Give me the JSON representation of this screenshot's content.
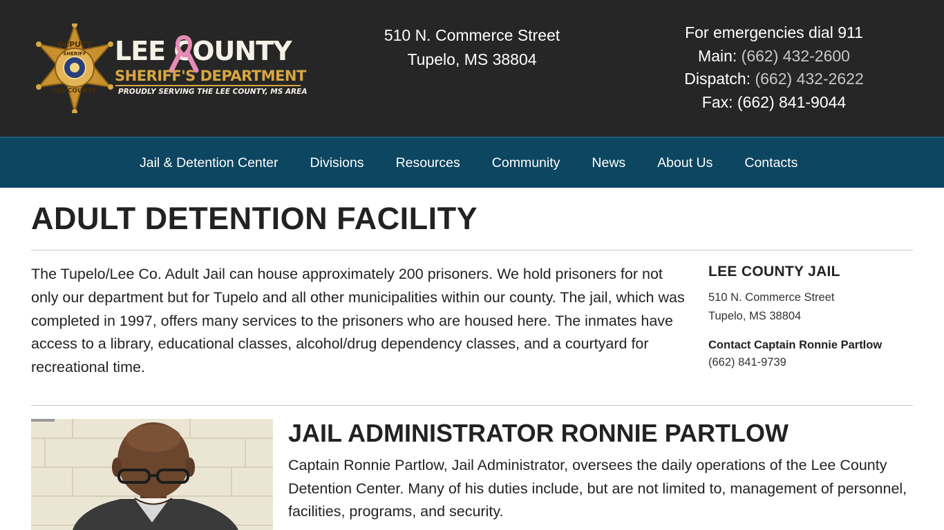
{
  "header": {
    "logo": {
      "badge_top": "DEPUTY",
      "badge_center": "SHERIFF",
      "badge_bottom": "LEE COUNTY",
      "title": "LEE COUNTY",
      "subtitle": "SHERIFF'S DEPARTMENT",
      "tagline": "PROUDLY SERVING THE LEE COUNTY, MS AREA"
    },
    "address": {
      "street": "510 N. Commerce Street",
      "city": "Tupelo, MS 38804"
    },
    "contact": {
      "emergency": "For emergencies dial 911",
      "main_label": "Main: ",
      "main_phone": "(662) 432-2600",
      "dispatch_label": "Dispatch: ",
      "dispatch_phone": "(662) 432-2622",
      "fax_label": "Fax: ",
      "fax_phone": "(662) 841-9044"
    }
  },
  "nav": {
    "items": [
      {
        "label": "Jail & Detention Center"
      },
      {
        "label": "Divisions"
      },
      {
        "label": "Resources"
      },
      {
        "label": "Community"
      },
      {
        "label": "News"
      },
      {
        "label": "About Us"
      },
      {
        "label": "Contacts"
      }
    ]
  },
  "main": {
    "title": "ADULT DETENTION FACILITY",
    "intro": "The Tupelo/Lee Co. Adult Jail can house approximately 200 prisoners. We hold prisoners for not only our department but for Tupelo and all other municipalities within our county. The jail, which was completed in 1997, offers many services to the prisoners who are housed here. The inmates have access to a library, educational classes, alcohol/drug dependency classes, and a courtyard for recreational time.",
    "sidebar": {
      "title": "LEE COUNTY JAIL",
      "street": "510 N. Commerce Street",
      "city": "Tupelo, MS 38804",
      "contact_label": "Contact Captain Ronnie Partlow",
      "phone": "(662) 841-9739"
    },
    "administrator": {
      "title": "JAIL ADMINISTRATOR RONNIE PARTLOW",
      "bio": "Captain Ronnie Partlow, Jail Administrator, oversees the daily operations of the Lee County Detention Center. Many of his duties include, but are not limited to, management of personnel, facilities, programs, and security."
    }
  },
  "colors": {
    "header_bg": "#262626",
    "nav_bg": "#0d4660",
    "logo_gold": "#d7a741",
    "ribbon_pink": "#e68bb6"
  }
}
